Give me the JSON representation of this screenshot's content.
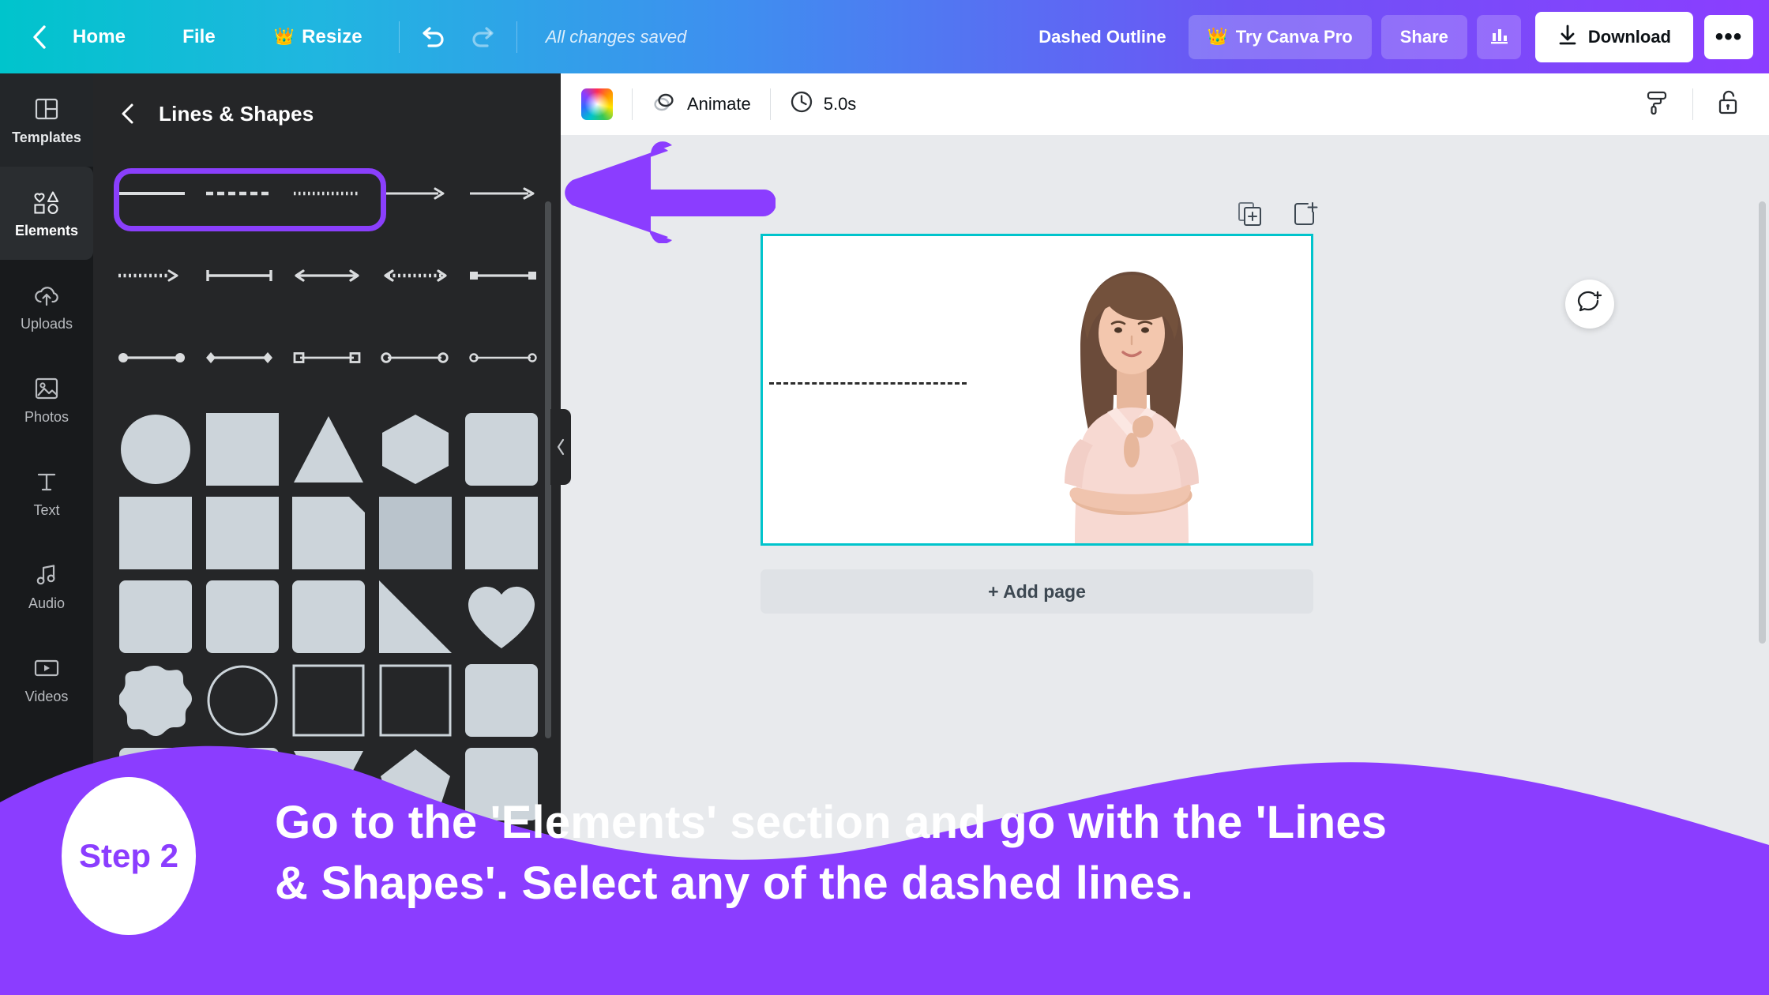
{
  "topbar": {
    "back_icon": "chevron-left-icon",
    "home": "Home",
    "file": "File",
    "resize": "Resize",
    "resize_crown_icon": "👑",
    "undo_icon": "undo-icon",
    "redo_icon": "redo-icon",
    "status": "All changes saved",
    "design_title": "Dashed Outline",
    "try_pro": "Try Canva Pro",
    "try_pro_crown_icon": "👑",
    "share": "Share",
    "analytics_icon": "bar-chart-icon",
    "download": "Download",
    "download_icon": "download-arrow-icon",
    "more": "•••"
  },
  "rail": {
    "items": [
      {
        "label": "Templates",
        "icon": "templates-icon",
        "state": "semi"
      },
      {
        "label": "Elements",
        "icon": "elements-icon",
        "state": "active"
      },
      {
        "label": "Uploads",
        "icon": "uploads-cloud-icon",
        "state": ""
      },
      {
        "label": "Photos",
        "icon": "photos-image-icon",
        "state": ""
      },
      {
        "label": "Text",
        "icon": "text-t-icon",
        "state": ""
      },
      {
        "label": "Audio",
        "icon": "audio-note-icon",
        "state": ""
      },
      {
        "label": "Videos",
        "icon": "videos-play-icon",
        "state": ""
      }
    ]
  },
  "panel": {
    "back_icon": "chevron-left-icon",
    "title": "Lines & Shapes",
    "line_rows": [
      {
        "selected": true,
        "items": [
          "solid-line",
          "dashed-line",
          "dotted-line",
          "line-with-arrow",
          "long-line-with-arrow"
        ]
      },
      {
        "selected": false,
        "items": [
          "dotted-line-arrow",
          "line-with-bar-ends",
          "double-arrow-line",
          "dotted-double-arrow",
          "square-to-square-line"
        ]
      },
      {
        "selected": false,
        "items": [
          "circle-end-line",
          "diamond-end-line",
          "open-square-end-line",
          "open-circle-end-line",
          "small-open-circle-line"
        ]
      }
    ],
    "shape_rows": [
      [
        "circle",
        "square",
        "triangle",
        "hexagon",
        "rounded-square"
      ],
      [
        "square-2",
        "square-3",
        "square-4",
        "square-highlighted",
        "square-5"
      ],
      [
        "rounded-square-2",
        "rounded-square-3",
        "rounded-square-4",
        "right-triangle",
        "heart"
      ],
      [
        "blob",
        "circle-outline",
        "square-outline",
        "square-outline-2",
        "rounded-square-6"
      ],
      [
        "rounded-square-7",
        "rounded-square-8",
        "triangle-down",
        "pentagon",
        "shape"
      ]
    ]
  },
  "editor": {
    "color_swatch": "rainbow-color-swatch",
    "animate": "Animate",
    "animate_icon": "animate-icon",
    "duration": "5.0s",
    "duration_icon": "clock-icon",
    "paint_roller_icon": "paint-roller-icon",
    "lock_icon": "unlocked-padlock-icon",
    "duplicate_page_icon": "duplicate-page-icon",
    "add_page_icon": "add-page-icon",
    "comment_icon": "add-comment-icon",
    "add_page": "+ Add page"
  },
  "overlay": {
    "arrow": "left-pointing-arrow",
    "step_label": "Step 2",
    "caption_line_1": "Go to the 'Elements' section and go with the 'Lines",
    "caption_line_2": "& Shapes'. Select any of the dashed lines."
  },
  "colors": {
    "brand_purple": "#8b3dff",
    "canva_teal": "#00c4cc",
    "panel_dark": "#252628",
    "rail_dark": "#181a1c",
    "shape_gray": "#ccd4da",
    "editor_bg": "#e8eaed"
  }
}
